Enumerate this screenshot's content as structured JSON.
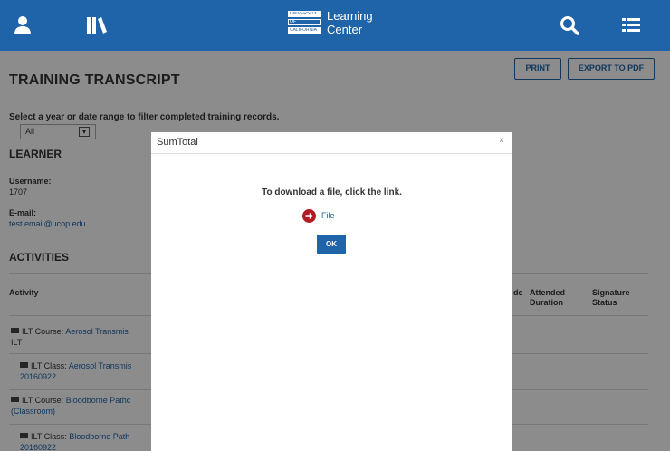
{
  "header": {
    "brand": {
      "logo_lines": [
        "UNIVERSITY",
        "OF",
        "CALIFORNIA"
      ],
      "line1": "Learning",
      "line2": "Center"
    },
    "icons": [
      "user-icon",
      "library-icon",
      "search-icon",
      "menu-icon"
    ],
    "color": "#1f64a8"
  },
  "page": {
    "title": "TRAINING TRANSCRIPT",
    "print_label": "PRINT",
    "export_label": "EXPORT TO PDF",
    "filter_label": "Select a year or date range to filter completed training records.",
    "filter_value": "All",
    "learner": {
      "heading": "LEARNER",
      "username_label": "Username:",
      "username_value": "1707",
      "email_label": "E-mail:",
      "email_value": "test.email@ucop.edu"
    },
    "activities": {
      "heading": "ACTIVITIES",
      "columns": {
        "activity": "Activity",
        "grade_partial": "de",
        "attended_duration_1": "Attended",
        "attended_duration_2": "Duration",
        "signature_status_1": "Signature",
        "signature_status_2": "Status"
      },
      "rows": [
        {
          "prefix": "ILT Course:",
          "link": "Aerosol Transmis",
          "sub": "ILT"
        },
        {
          "prefix": "ILT Class:",
          "link": "Aerosol Transmis",
          "sub": "20160922"
        },
        {
          "prefix": "ILT Course:",
          "link": "Bloodborne Pathc",
          "sub": "(Classroom)"
        },
        {
          "prefix": "ILT Class:",
          "link": "Bloodborne Path",
          "sub": "20160922"
        }
      ]
    }
  },
  "dialog": {
    "title": "SumTotal",
    "close": "×",
    "message": "To download a file, click the link.",
    "file_link": "File",
    "ok_label": "OK"
  }
}
